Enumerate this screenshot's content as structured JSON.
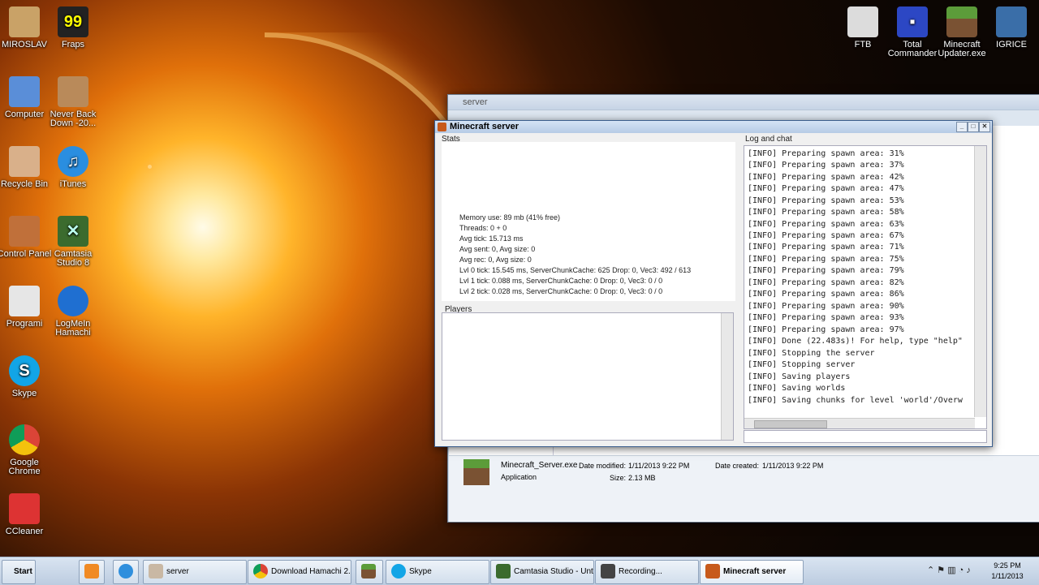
{
  "desktop": {
    "icons_left": [
      {
        "label": "MIROSLAV",
        "icon": "folder-user-icon"
      },
      {
        "label": "Fraps",
        "icon": "fraps-icon",
        "badge": "99"
      },
      {
        "label": "Computer",
        "icon": "computer-icon"
      },
      {
        "label": "Never Back Down -20...",
        "icon": "folder-icon"
      },
      {
        "label": "Recycle Bin",
        "icon": "recycle-bin-icon"
      },
      {
        "label": "iTunes",
        "icon": "itunes-icon"
      },
      {
        "label": "Control Panel",
        "icon": "control-panel-icon"
      },
      {
        "label": "Camtasia Studio 8",
        "icon": "camtasia-icon"
      },
      {
        "label": "Programi",
        "icon": "folder-icon"
      },
      {
        "label": "LogMeIn Hamachi",
        "icon": "hamachi-icon"
      },
      {
        "label": "Skype",
        "icon": "skype-icon"
      },
      {
        "label": "Google Chrome",
        "icon": "chrome-icon"
      },
      {
        "label": "CCleaner",
        "icon": "ccleaner-icon"
      }
    ],
    "icons_right": [
      {
        "label": "FTB",
        "icon": "folder-icon"
      },
      {
        "label": "Total Commander",
        "icon": "floppy-icon"
      },
      {
        "label": "Minecraft Updater.exe",
        "icon": "minecraft-icon"
      },
      {
        "label": "IGRICE",
        "icon": "folder-icon"
      }
    ]
  },
  "explorer": {
    "title": "server",
    "file": {
      "name": "Minecraft_Server.exe",
      "type": "Application",
      "modified_label": "Date modified:",
      "modified": "1/11/2013 9:22 PM",
      "size_label": "Size:",
      "size": "2.13 MB",
      "created_label": "Date created:",
      "created": "1/11/2013 9:22 PM"
    }
  },
  "mc": {
    "title": "Minecraft server",
    "stats_label": "Stats",
    "players_label": "Players",
    "log_label": "Log and chat",
    "stats": [
      "Memory use: 89 mb (41% free)",
      "Threads: 0 + 0",
      "Avg tick: 15.713 ms",
      "Avg sent: 0, Avg size: 0",
      "Avg rec: 0, Avg size: 0",
      "Lvl 0 tick: 15.545 ms, ServerChunkCache: 625 Drop: 0, Vec3: 492 / 613",
      "Lvl 1 tick: 0.088 ms, ServerChunkCache: 0 Drop: 0, Vec3: 0 / 0",
      "Lvl 2 tick: 0.028 ms, ServerChunkCache: 0 Drop: 0, Vec3: 0 / 0"
    ],
    "log": [
      "[INFO] Preparing spawn area: 31%",
      "[INFO] Preparing spawn area: 37%",
      "[INFO] Preparing spawn area: 42%",
      "[INFO] Preparing spawn area: 47%",
      "[INFO] Preparing spawn area: 53%",
      "[INFO] Preparing spawn area: 58%",
      "[INFO] Preparing spawn area: 63%",
      "[INFO] Preparing spawn area: 67%",
      "[INFO] Preparing spawn area: 71%",
      "[INFO] Preparing spawn area: 75%",
      "[INFO] Preparing spawn area: 79%",
      "[INFO] Preparing spawn area: 82%",
      "[INFO] Preparing spawn area: 86%",
      "[INFO] Preparing spawn area: 90%",
      "[INFO] Preparing spawn area: 93%",
      "[INFO] Preparing spawn area: 97%",
      "[INFO] Done (22.483s)! For help, type \"help\"",
      "[INFO] Stopping the server",
      "[INFO] Stopping server",
      "[INFO] Saving players",
      "[INFO] Saving worlds",
      "[INFO] Saving chunks for level 'world'/Overw"
    ]
  },
  "taskbar": {
    "start": "Start",
    "items": [
      {
        "label": "server",
        "icon": "folder-icon"
      },
      {
        "label": "Download Hamachi 2....",
        "icon": "chrome-icon"
      },
      {
        "label": "Skype",
        "icon": "skype-icon"
      },
      {
        "label": "Camtasia Studio - Unt...",
        "icon": "camtasia-icon"
      },
      {
        "label": "Recording...",
        "icon": "recording-icon"
      },
      {
        "label": "Minecraft server",
        "icon": "java-icon"
      }
    ],
    "time": "9:25 PM",
    "date": "1/11/2013"
  }
}
